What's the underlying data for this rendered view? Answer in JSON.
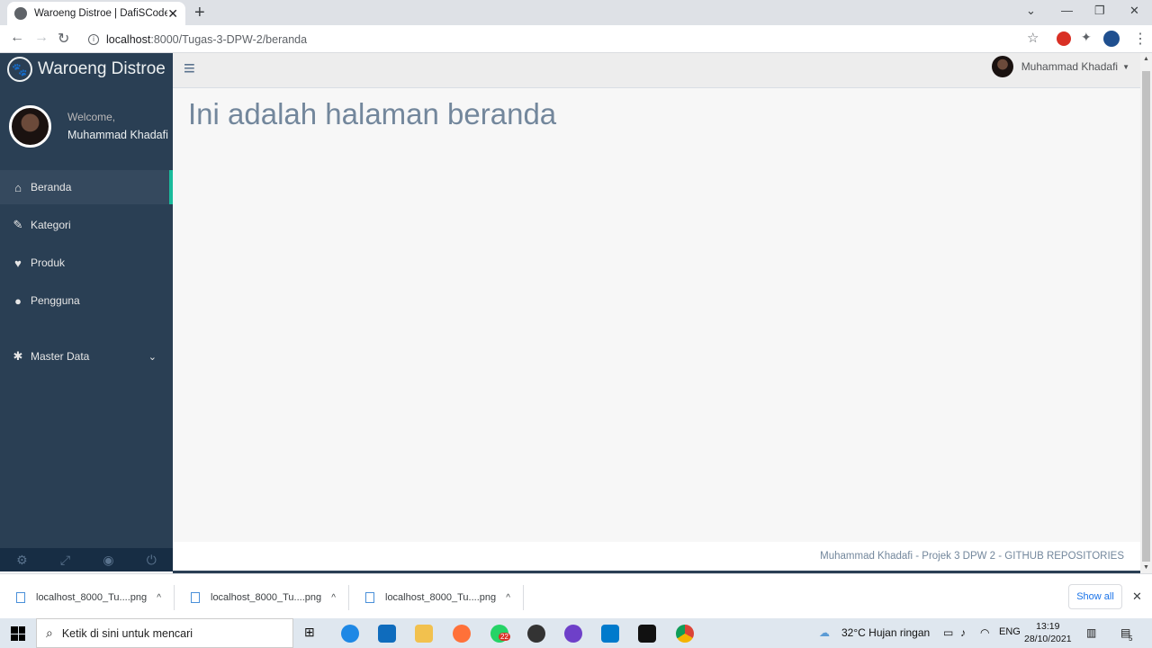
{
  "browser": {
    "tab_title": "Waroeng Distroe | DafiSCode",
    "url_host": "localhost",
    "url_rest": ":8000/Tugas-3-DPW-2/beranda"
  },
  "sidebar": {
    "brand": "Waroeng Distroe",
    "welcome": "Welcome,",
    "user": "Muhammad Khadafi",
    "items": [
      {
        "label": "Beranda",
        "icon": "home-icon"
      },
      {
        "label": "Kategori",
        "icon": "pencil-icon"
      },
      {
        "label": "Produk",
        "icon": "heart-icon"
      },
      {
        "label": "Pengguna",
        "icon": "user-icon"
      }
    ],
    "master": "Master Data"
  },
  "topnav": {
    "user": "Muhammad Khadafi"
  },
  "main": {
    "heading": "Ini adalah halaman beranda"
  },
  "footer": {
    "text": "Muhammad Khadafi - Projek 3 DPW 2 - GITHUB REPOSITORIES"
  },
  "downloads": {
    "files": [
      "localhost_8000_Tu....png",
      "localhost_8000_Tu....png",
      "localhost_8000_Tu....png"
    ],
    "show_all": "Show all"
  },
  "taskbar": {
    "search_placeholder": "Ketik di sini untuk mencari",
    "weather": "32°C  Hujan ringan",
    "lang": "ENG",
    "time": "13:19",
    "date": "28/10/2021",
    "whatsapp_badge": "22",
    "notif_count": "5"
  }
}
